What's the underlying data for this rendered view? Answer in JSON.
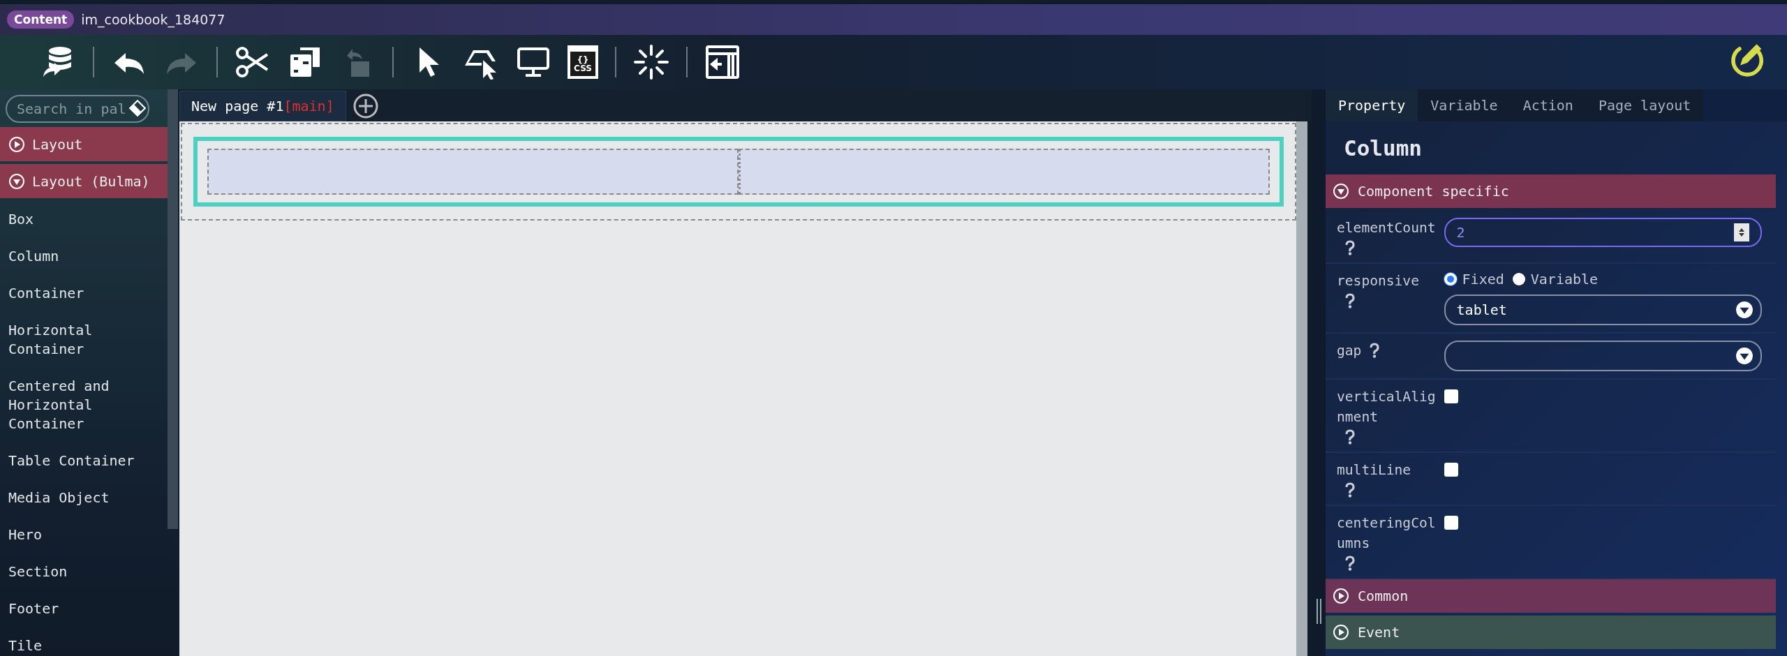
{
  "header": {
    "badge": "Content",
    "title": "im_cookbook_184077"
  },
  "toolbar": [
    {
      "kind": "database",
      "disabled": false
    },
    {
      "kind": "divider"
    },
    {
      "kind": "undo",
      "disabled": false
    },
    {
      "kind": "redo",
      "disabled": true
    },
    {
      "kind": "divider"
    },
    {
      "kind": "cut",
      "disabled": false
    },
    {
      "kind": "copy",
      "disabled": false
    },
    {
      "kind": "paste",
      "disabled": true
    },
    {
      "kind": "divider"
    },
    {
      "kind": "pointer",
      "disabled": false
    },
    {
      "kind": "area-select",
      "disabled": false
    },
    {
      "kind": "monitor",
      "disabled": false
    },
    {
      "kind": "css",
      "label": "CSS",
      "braces": "{}",
      "disabled": false
    },
    {
      "kind": "divider"
    },
    {
      "kind": "spinner",
      "disabled": false
    },
    {
      "kind": "divider"
    },
    {
      "kind": "panel",
      "disabled": false
    }
  ],
  "palette": {
    "search_placeholder": "Search in pal",
    "groups": [
      {
        "label": "Layout",
        "expanded": false,
        "color": "#8a3a4c"
      },
      {
        "label": "Layout (Bulma)",
        "expanded": true,
        "color": "#8a3a4c",
        "items": [
          "Box",
          "Column",
          "Container",
          "Horizontal Container",
          "Centered and Horizontal Container",
          "Table Container",
          "Media Object",
          "Hero",
          "Section",
          "Footer",
          "Tile"
        ]
      }
    ]
  },
  "canvas": {
    "tabs": [
      {
        "label": "New page #1",
        "tag": "[main]"
      }
    ]
  },
  "properties": {
    "tabs": [
      {
        "label": "Property",
        "selected": true
      },
      {
        "label": "Variable",
        "selected": false
      },
      {
        "label": "Action",
        "selected": false
      },
      {
        "label": "Page layout",
        "selected": false
      }
    ],
    "title": "Column",
    "sections": [
      {
        "label": "Component specific",
        "expanded": true,
        "color": "#7a3450",
        "fields": [
          {
            "kind": "number",
            "label": "elementCount",
            "value": "2"
          },
          {
            "kind": "radio-select",
            "label": "responsive",
            "options": [
              {
                "label": "Fixed",
                "selected": true
              },
              {
                "label": "Variable",
                "selected": false
              }
            ],
            "value": "tablet"
          },
          {
            "kind": "select",
            "label": "gap"
          },
          {
            "kind": "checkbox",
            "label": "verticalAlignment",
            "checked": false
          },
          {
            "kind": "checkbox",
            "label": "multiLine",
            "checked": false
          },
          {
            "kind": "checkbox",
            "label": "centeringColumns",
            "checked": false
          }
        ]
      },
      {
        "label": "Common",
        "expanded": false,
        "color": "#6e3458"
      },
      {
        "label": "Event",
        "expanded": false,
        "color": "#3c5450"
      }
    ]
  }
}
